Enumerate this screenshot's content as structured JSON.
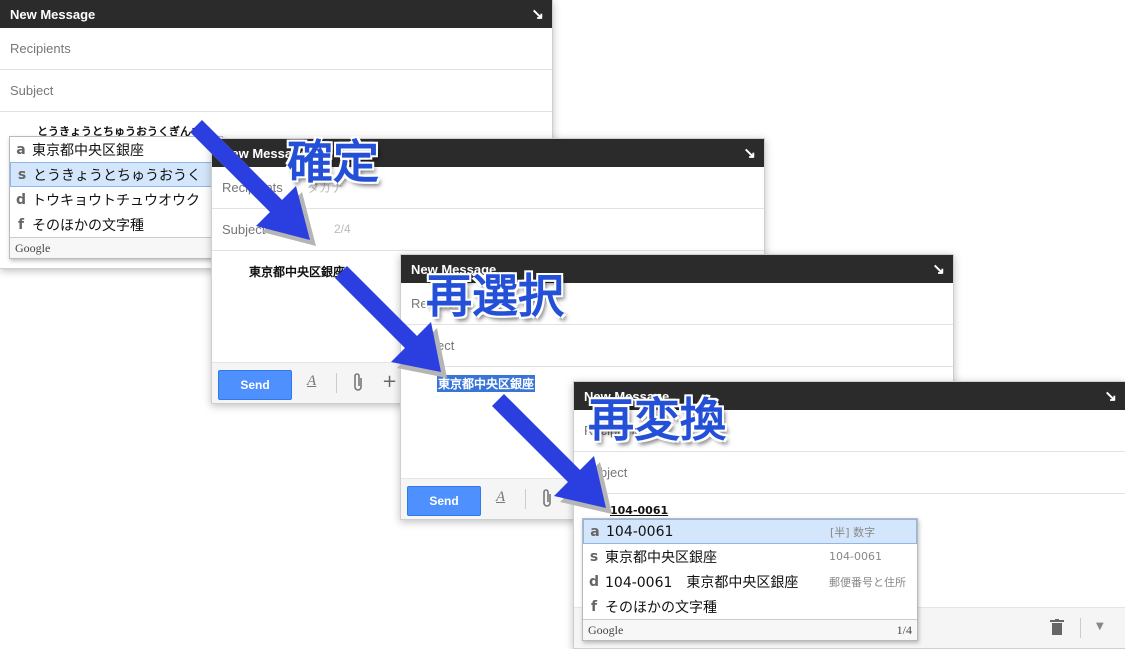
{
  "window_title": "New Message",
  "fields": {
    "recipients": "Recipients",
    "subject": "Subject"
  },
  "toolbar": {
    "send_label": "Send",
    "format_icon": "A",
    "attach_icon": "paperclip-icon",
    "plus_label": "+"
  },
  "win1": {
    "composing": "とうきょうとちゅうおうくぎんざ",
    "candidates": [
      {
        "key": "a",
        "text": "東京都中央区銀座"
      },
      {
        "key": "s",
        "text": "とうきょうとちゅうおうく"
      },
      {
        "key": "d",
        "text": "トウキョウトチュウオウク"
      },
      {
        "key": "f",
        "text": "そのほかの文字種"
      }
    ],
    "footer_brand": "Google"
  },
  "win2": {
    "committed": "東京都中央区銀座",
    "ghost_recipients": "キ",
    "ghost_katakana": "タカナ",
    "ghost_count": "2/4"
  },
  "win3": {
    "selected": "東京都中央区銀座"
  },
  "win4": {
    "composing": "104-0061",
    "candidates": [
      {
        "key": "a",
        "text": "104-0061",
        "desc": "[半] 数字"
      },
      {
        "key": "s",
        "text": "東京都中央区銀座",
        "desc": "104-0061"
      },
      {
        "key": "d",
        "text": "104-0061　東京都中央区銀座",
        "desc": "郵便番号と住所"
      },
      {
        "key": "f",
        "text": "そのほかの文字種",
        "desc": ""
      }
    ],
    "footer_brand": "Google",
    "footer_count": "1/4",
    "trash_icon": "trash-icon",
    "more_icon": "chevron-down-icon"
  },
  "labels": {
    "confirm": "確定",
    "reselect": "再選択",
    "reconvert": "再変換"
  },
  "colors": {
    "titlebar": "#2b2b2b",
    "send": "#4d90fe",
    "arrow": "#2b3fe0",
    "label": "#2450d8",
    "selection": "#3875d7"
  }
}
